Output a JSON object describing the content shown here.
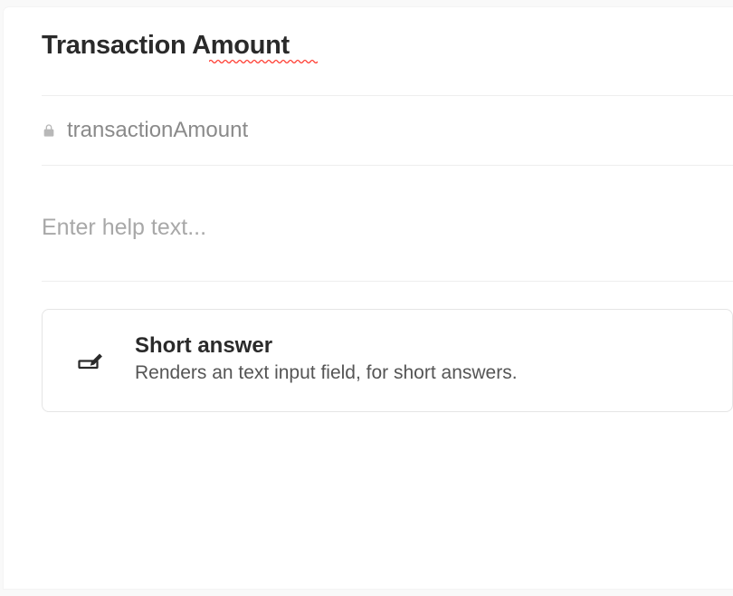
{
  "title": "Transaction Amount",
  "identifier": "transactionAmount",
  "helpText": {
    "value": "",
    "placeholder": "Enter help text..."
  },
  "fieldType": {
    "title": "Short answer",
    "description": "Renders an text input field, for short answers."
  }
}
